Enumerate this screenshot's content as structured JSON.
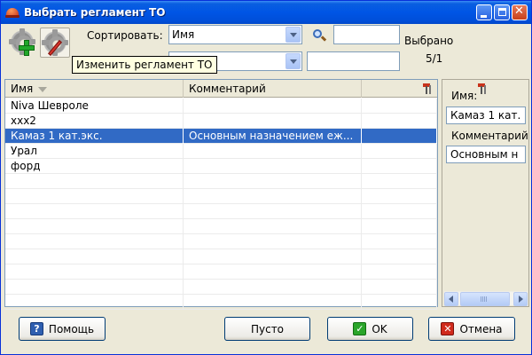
{
  "window": {
    "title": "Выбрать регламент ТО"
  },
  "toolbar": {
    "sort_label": "Сортировать:",
    "sort_value": "Имя",
    "search_value": "",
    "filter_value": "",
    "filter_search_value": "",
    "selected_label": "Выбрано",
    "selected_count": "5/1",
    "tooltip": "Изменить регламент ТО"
  },
  "grid": {
    "columns": [
      "Имя",
      "Комментарий"
    ],
    "rows": [
      {
        "name": "Niva Шевроле",
        "comment": ""
      },
      {
        "name": "xxx2",
        "comment": ""
      },
      {
        "name": "Камаз 1 кат.экс.",
        "comment": "Основным назначением еж..."
      },
      {
        "name": "Урал",
        "comment": ""
      },
      {
        "name": "форд",
        "comment": ""
      }
    ],
    "selected_index": 2
  },
  "side": {
    "name_label": "Имя:",
    "name_value": "Камаз 1 кат.",
    "comment_label": "Комментарий",
    "comment_value": "Основным н"
  },
  "buttons": {
    "help": "Помощь",
    "empty": "Пусто",
    "ok": "OK",
    "cancel": "Отмена"
  },
  "icons": {
    "help": "?",
    "ok": "✓",
    "cancel": "✕",
    "close": "✕"
  }
}
